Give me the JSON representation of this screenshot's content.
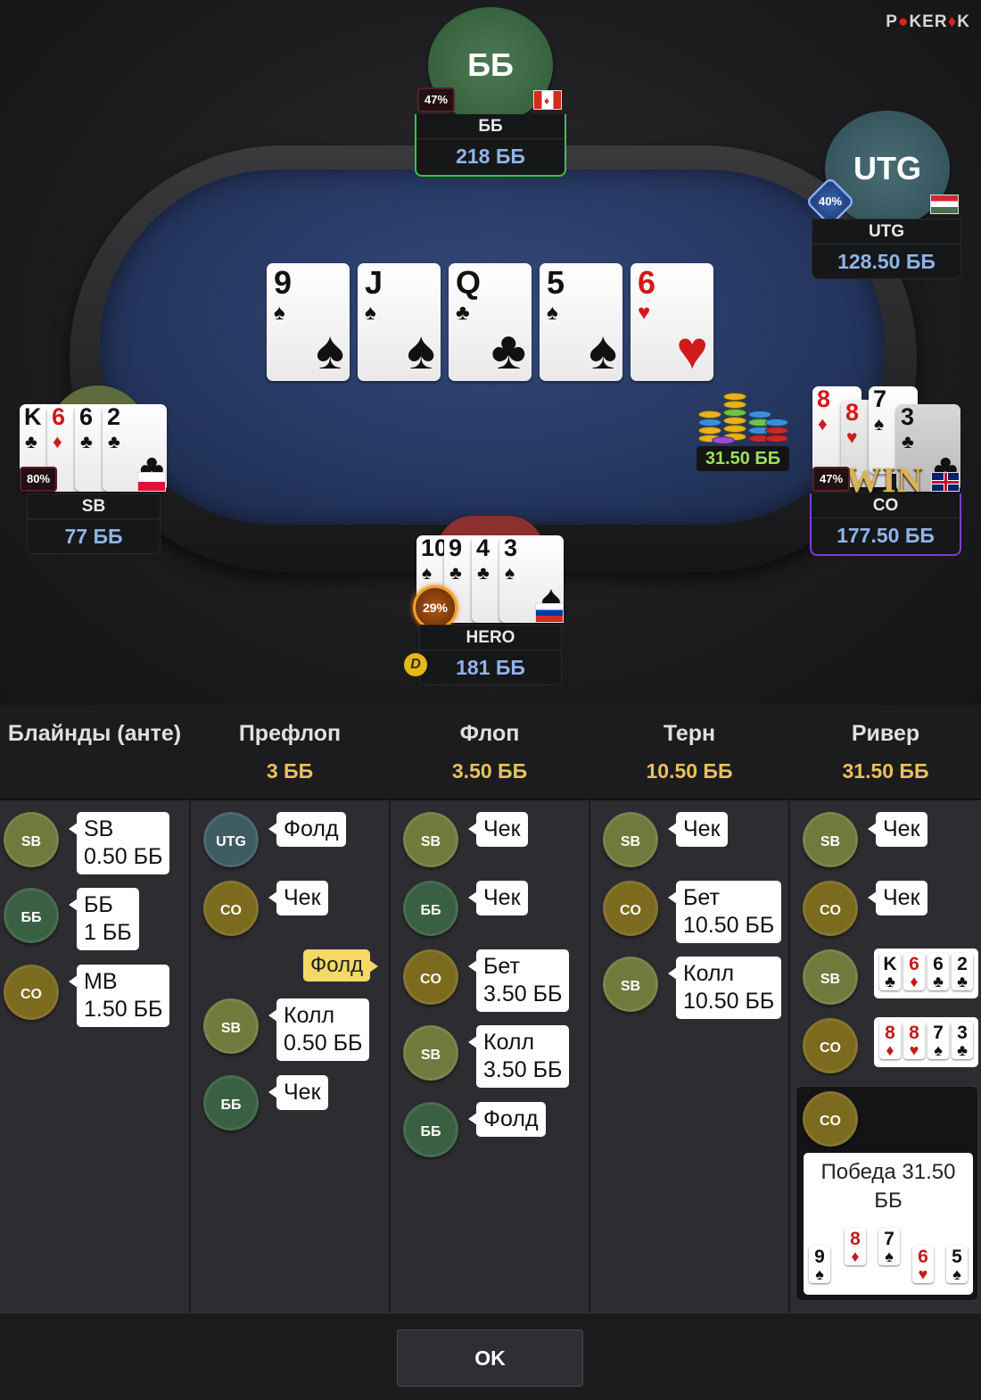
{
  "brand": {
    "name_a": "P",
    "name_b": "KER",
    "name_c": "K"
  },
  "board": [
    {
      "rank": "9",
      "suit": "♠",
      "red": false
    },
    {
      "rank": "J",
      "suit": "♠",
      "red": false
    },
    {
      "rank": "Q",
      "suit": "♣",
      "red": false
    },
    {
      "rank": "5",
      "suit": "♠",
      "red": false
    },
    {
      "rank": "6",
      "suit": "♥",
      "red": true
    }
  ],
  "players": {
    "bb": {
      "avatar": "ББ",
      "pct": "47%",
      "name": "ББ",
      "stack": "218 ББ",
      "flag": "canada-flag"
    },
    "utg": {
      "avatar": "UTG",
      "pct": "40%",
      "name": "UTG",
      "stack": "128.50 ББ",
      "flag": "hungary-flag"
    },
    "sb": {
      "pct": "80%",
      "name": "SB",
      "stack": "77 ББ",
      "flag": "poland-flag",
      "cards": [
        {
          "rank": "K",
          "suit": "♣",
          "red": false
        },
        {
          "rank": "6",
          "suit": "♦",
          "red": true
        },
        {
          "rank": "6",
          "suit": "♣",
          "red": false
        },
        {
          "rank": "2",
          "suit": "♣",
          "red": false
        }
      ]
    },
    "co": {
      "pct": "47%",
      "name": "CO",
      "stack": "177.50 ББ",
      "flag": "uk-flag",
      "win": "WIN",
      "cards": [
        {
          "rank": "8",
          "suit": "♦",
          "red": true
        },
        {
          "rank": "8",
          "suit": "♥",
          "red": true
        },
        {
          "rank": "7",
          "suit": "♠",
          "red": false
        },
        {
          "rank": "3",
          "suit": "♣",
          "red": false
        }
      ]
    },
    "hero": {
      "pct": "29%",
      "name": "HERO",
      "stack": "181 ББ",
      "flag": "russia-flag",
      "dealer": "D",
      "cards": [
        {
          "rank": "10",
          "suit": "♠",
          "red": false
        },
        {
          "rank": "9",
          "suit": "♣",
          "red": false
        },
        {
          "rank": "4",
          "suit": "♣",
          "red": false
        },
        {
          "rank": "3",
          "suit": "♠",
          "red": false
        }
      ]
    }
  },
  "pot": "31.50 ББ",
  "colors": {
    "accent_gold": "#e8c25a",
    "stack_blue": "#8fb4e8",
    "pot_green": "#9ae05a",
    "felt": "#263862"
  },
  "history": {
    "columns": [
      {
        "title": "Блайнды (анте)",
        "pot": ""
      },
      {
        "title": "Префлоп",
        "pot": "3 ББ"
      },
      {
        "title": "Флоп",
        "pot": "3.50 ББ"
      },
      {
        "title": "Терн",
        "pot": "10.50 ББ"
      },
      {
        "title": "Ривер",
        "pot": "31.50 ББ"
      }
    ],
    "blinds": [
      {
        "pos": "SB",
        "l1": "SB",
        "l2": "0.50 ББ"
      },
      {
        "pos": "ББ",
        "l1": "ББ",
        "l2": "1 ББ"
      },
      {
        "pos": "CO",
        "l1": "MB",
        "l2": "1.50 ББ"
      }
    ],
    "preflop": [
      {
        "pos": "UTG",
        "l1": "Фолд",
        "l2": ""
      },
      {
        "pos": "CO",
        "l1": "Чек",
        "l2": ""
      },
      {
        "pos": "",
        "l1": "Фолд",
        "l2": "",
        "hero": true
      },
      {
        "pos": "SB",
        "l1": "Колл",
        "l2": "0.50 ББ"
      },
      {
        "pos": "ББ",
        "l1": "Чек",
        "l2": ""
      }
    ],
    "flop": [
      {
        "pos": "SB",
        "l1": "Чек",
        "l2": ""
      },
      {
        "pos": "ББ",
        "l1": "Чек",
        "l2": ""
      },
      {
        "pos": "CO",
        "l1": "Бет",
        "l2": "3.50 ББ"
      },
      {
        "pos": "SB",
        "l1": "Колл",
        "l2": "3.50 ББ"
      },
      {
        "pos": "ББ",
        "l1": "Фолд",
        "l2": ""
      }
    ],
    "turn": [
      {
        "pos": "SB",
        "l1": "Чек",
        "l2": ""
      },
      {
        "pos": "CO",
        "l1": "Бет",
        "l2": "10.50 ББ"
      },
      {
        "pos": "SB",
        "l1": "Колл",
        "l2": "10.50 ББ"
      }
    ],
    "river": [
      {
        "pos": "SB",
        "l1": "Чек"
      },
      {
        "pos": "CO",
        "l1": "Чек"
      },
      {
        "pos": "SB",
        "shown": [
          {
            "rank": "K",
            "suit": "♣",
            "red": false
          },
          {
            "rank": "6",
            "suit": "♦",
            "red": true
          },
          {
            "rank": "6",
            "suit": "♣",
            "red": false
          },
          {
            "rank": "2",
            "suit": "♣",
            "red": false
          }
        ]
      },
      {
        "pos": "CO",
        "shown": [
          {
            "rank": "8",
            "suit": "♦",
            "red": true
          },
          {
            "rank": "8",
            "suit": "♥",
            "red": true
          },
          {
            "rank": "7",
            "suit": "♠",
            "red": false
          },
          {
            "rank": "3",
            "suit": "♣",
            "red": false
          }
        ]
      }
    ],
    "winner": {
      "pos": "CO",
      "text": "Победа 31.50 ББ",
      "cards": [
        {
          "rank": "9",
          "suit": "♠",
          "red": false
        },
        {
          "rank": "8",
          "suit": "♦",
          "red": true
        },
        {
          "rank": "7",
          "suit": "♠",
          "red": false
        },
        {
          "rank": "6",
          "suit": "♥",
          "red": true
        },
        {
          "rank": "5",
          "suit": "♠",
          "red": false
        }
      ]
    }
  },
  "ok_label": "OK"
}
